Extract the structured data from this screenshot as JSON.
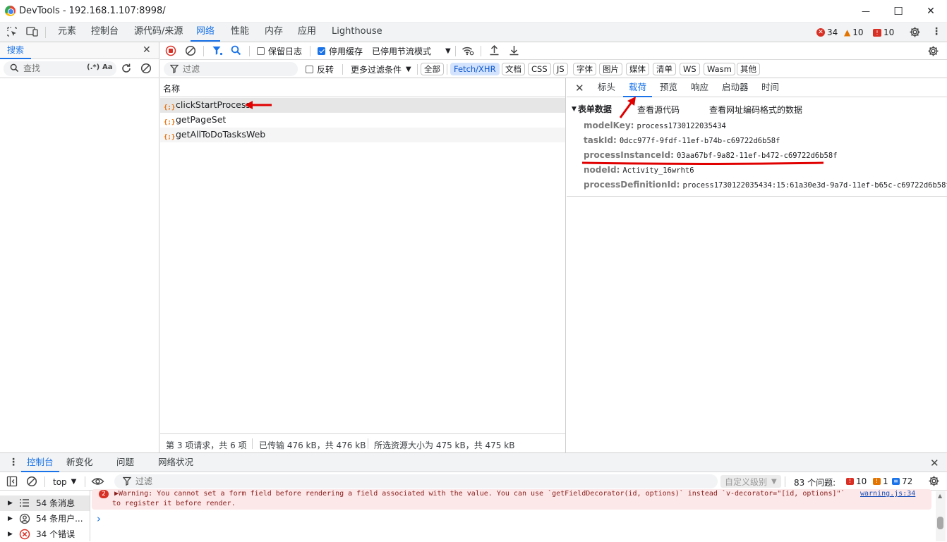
{
  "window": {
    "title": "DevTools - 192.168.1.107:8998/",
    "minimize_glyph": "—",
    "maximize_glyph": "☐",
    "close_glyph": "✕"
  },
  "main_tabs": [
    "元素",
    "控制台",
    "源代码/来源",
    "网络",
    "性能",
    "内存",
    "应用",
    "Lighthouse"
  ],
  "active_main_tab": "网络",
  "issue_counts": {
    "errors": "34",
    "warnings": "10",
    "issues": "10"
  },
  "search_pane": {
    "tab_label": "搜索",
    "input_placeholder": "查找",
    "regex_label": "(.*)",
    "case_label": "Aa"
  },
  "network_toolbar": {
    "preserve_log_label": "保留日志",
    "preserve_log_checked": false,
    "disable_cache_label": "停用缓存",
    "disable_cache_checked": true,
    "throttle_label": "已停用节流模式"
  },
  "filter_bar": {
    "filter_placeholder": "过滤",
    "invert_label": "反转",
    "more_filters_label": "更多过滤条件",
    "type_chips": [
      "全部",
      "Fetch/XHR",
      "文档",
      "CSS",
      "JS",
      "字体",
      "图片",
      "媒体",
      "清单",
      "WS",
      "Wasm",
      "其他"
    ],
    "active_chip": "Fetch/XHR"
  },
  "request_list": {
    "column_name": "名称",
    "requests": [
      {
        "name": "clickStartProcess",
        "selected": true
      },
      {
        "name": "getPageSet",
        "selected": false
      },
      {
        "name": "getAllToDoTasksWeb",
        "selected": false
      }
    ],
    "status": {
      "count": "第 3 项请求，共 6 项",
      "transferred": "已传输 476 kB，共 476 kB",
      "resources": "所选资源大小为 475 kB，共 475 kB"
    }
  },
  "detail_pane": {
    "tabs": [
      "标头",
      "载荷",
      "预览",
      "响应",
      "启动器",
      "时间"
    ],
    "active_tab": "载荷",
    "section_title": "表单数据",
    "view_source": "查看源代码",
    "view_url_encoded": "查看网址编码格式的数据",
    "form_data": [
      {
        "key": "modelKey",
        "value": "process1730122035434"
      },
      {
        "key": "taskId",
        "value": "0dcc977f-9fdf-11ef-b74b-c69722d6b58f"
      },
      {
        "key": "processInstanceId",
        "value": "03aa67bf-9a82-11ef-b472-c69722d6b58f"
      },
      {
        "key": "nodeId",
        "value": "Activity_16wrht6"
      },
      {
        "key": "processDefinitionId",
        "value": "process1730122035434:15:61a30e3d-9a7d-11ef-b65c-c69722d6b58f"
      }
    ]
  },
  "drawer": {
    "tabs": [
      "控制台",
      "新变化",
      "问题",
      "网络状况"
    ],
    "active_tab": "控制台"
  },
  "console_toolbar": {
    "context": "top",
    "filter_placeholder": "过滤",
    "level_label": "自定义级别",
    "issues_label": "83 个问题:",
    "issue_errors": "10",
    "issue_warnings": "1",
    "issue_info": "72"
  },
  "console_sidebar": [
    {
      "label": "54 条消息",
      "icon": "list-icon"
    },
    {
      "label": "54 条用户...",
      "icon": "user-icon"
    },
    {
      "label": "34 个错误",
      "icon": "error-icon"
    }
  ],
  "console_message": {
    "repeat_count": "2",
    "line1": "▶Warning: You cannot set a form field before rendering a field associated with the value. You can use `getFieldDecorator(id, options)` instead `v-decorator=\"[id, options]\"`",
    "line2": "to register it before render.",
    "source_link": "warning.js:34"
  },
  "prompt_glyph": "›",
  "colors": {
    "accent": "#1a73e8",
    "annotation_red": "#e00000",
    "error_red": "#d93025",
    "warning_orange": "#e37400",
    "xhr_orange": "#e8710a"
  }
}
